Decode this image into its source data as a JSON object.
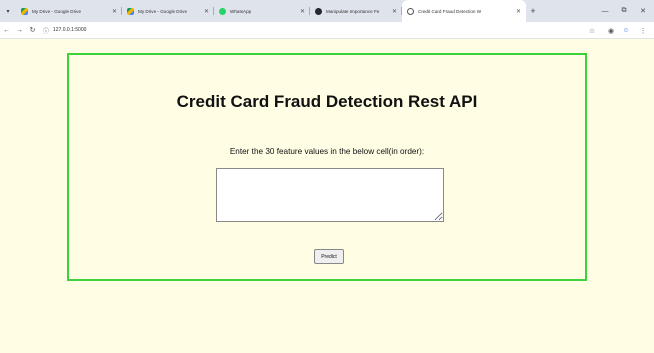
{
  "browser": {
    "tabs": [
      {
        "title": "My Drive - Google Drive",
        "favicon": "google-drive-icon",
        "active": false
      },
      {
        "title": "My Drive - Google Drive",
        "favicon": "google-drive-icon",
        "active": false
      },
      {
        "title": "WhatsApp",
        "favicon": "whatsapp-icon",
        "active": false
      },
      {
        "title": "Manipulate Importance Fe",
        "favicon": "github-icon",
        "active": false
      },
      {
        "title": "Credit Card Fraud Detection W",
        "favicon": "globe-icon",
        "active": true
      }
    ],
    "url": "127.0.0.1:5000"
  },
  "page": {
    "title": "Credit Card Fraud Detection Rest API",
    "prompt": "Enter the 30 feature values in the below cell(in order):",
    "features_value": "",
    "predict_label": "Predict"
  },
  "colors": {
    "page_background": "#fffee5",
    "panel_border": "#3dd13d",
    "tabbar_background": "#dfe3eb"
  }
}
